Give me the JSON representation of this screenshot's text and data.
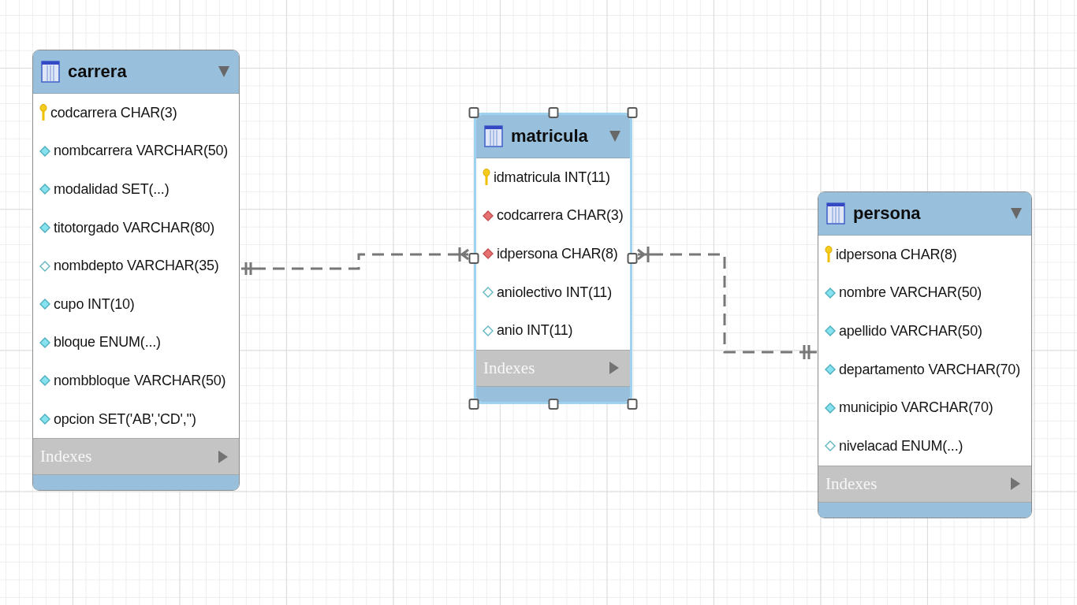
{
  "diagram": {
    "tables": [
      {
        "name": "carrera",
        "selected": false,
        "columns": [
          {
            "label": "codcarrera CHAR(3)",
            "kind": "primary_key"
          },
          {
            "label": "nombcarrera VARCHAR(50)",
            "kind": "not_null"
          },
          {
            "label": "modalidad SET(...)",
            "kind": "not_null"
          },
          {
            "label": "titotorgado VARCHAR(80)",
            "kind": "not_null"
          },
          {
            "label": "nombdepto VARCHAR(35)",
            "kind": "nullable"
          },
          {
            "label": "cupo INT(10)",
            "kind": "not_null"
          },
          {
            "label": "bloque ENUM(...)",
            "kind": "not_null"
          },
          {
            "label": "nombbloque VARCHAR(50)",
            "kind": "not_null"
          },
          {
            "label": "opcion SET('AB','CD','')",
            "kind": "not_null"
          }
        ],
        "indexes": "Indexes"
      },
      {
        "name": "matricula",
        "selected": true,
        "columns": [
          {
            "label": "idmatricula INT(11)",
            "kind": "primary_key"
          },
          {
            "label": "codcarrera CHAR(3)",
            "kind": "foreign_key"
          },
          {
            "label": "idpersona CHAR(8)",
            "kind": "foreign_key"
          },
          {
            "label": "aniolectivo INT(11)",
            "kind": "nullable"
          },
          {
            "label": "anio INT(11)",
            "kind": "nullable"
          }
        ],
        "indexes": "Indexes"
      },
      {
        "name": "persona",
        "selected": false,
        "columns": [
          {
            "label": "idpersona CHAR(8)",
            "kind": "primary_key"
          },
          {
            "label": "nombre VARCHAR(50)",
            "kind": "not_null"
          },
          {
            "label": "apellido VARCHAR(50)",
            "kind": "not_null"
          },
          {
            "label": "departamento VARCHAR(70)",
            "kind": "not_null"
          },
          {
            "label": "municipio VARCHAR(70)",
            "kind": "not_null"
          },
          {
            "label": "nivelacad ENUM(...)",
            "kind": "nullable"
          }
        ],
        "indexes": "Indexes"
      }
    ],
    "relationships": [
      {
        "identifying": false
      },
      {
        "identifying": false
      }
    ]
  }
}
